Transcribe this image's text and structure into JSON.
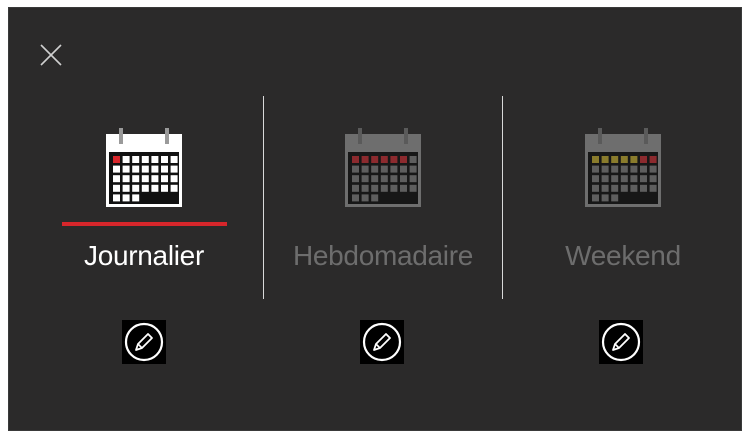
{
  "dialog": {
    "close_icon": "close-icon",
    "modes": [
      {
        "label": "Journalier",
        "state": "active",
        "icon": "calendar-daily-icon"
      },
      {
        "label": "Hebdomadaire",
        "state": "inactive",
        "icon": "calendar-weekly-icon"
      },
      {
        "label": "Weekend",
        "state": "inactive",
        "icon": "calendar-weekend-icon"
      }
    ],
    "edit_icon": "pencil-icon"
  },
  "colors": {
    "background": "#2b2a2a",
    "active_text": "#ffffff",
    "inactive_text": "#6d6d6d",
    "accent_red": "#d7262b",
    "weekday_dim_red": "#8c2a2e",
    "weekend_yellow": "#8a7c2c"
  }
}
